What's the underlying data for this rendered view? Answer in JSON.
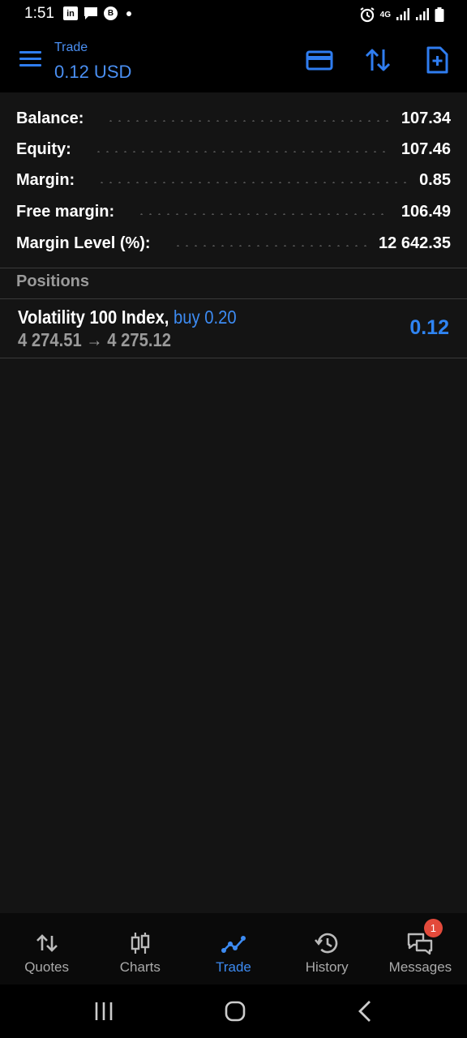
{
  "status_bar": {
    "time": "1:51",
    "left_icons": [
      "linkedin-icon",
      "chat-icon",
      "b-app-icon",
      "dot-icon"
    ],
    "right_icons": [
      "alarm-icon",
      "4g-icon",
      "signal-icon",
      "signal-icon",
      "battery-icon"
    ],
    "network": "4G"
  },
  "header": {
    "title": "Trade",
    "subtitle": "0.12 USD",
    "actions": [
      "card-icon",
      "sort-icon",
      "new-order-icon"
    ]
  },
  "summary": {
    "rows": [
      {
        "label": "Balance:",
        "value": "107.34"
      },
      {
        "label": "Equity:",
        "value": "107.46"
      },
      {
        "label": "Margin:",
        "value": "0.85"
      },
      {
        "label": "Free margin:",
        "value": "106.49"
      },
      {
        "label": "Margin Level (%):",
        "value": "12 642.35"
      }
    ]
  },
  "positions": {
    "title": "Positions",
    "items": [
      {
        "symbol": "Volatility 100 Index,",
        "side": "buy 0.20",
        "prices": "4 274.51 → 4 275.12",
        "profit": "0.12"
      }
    ]
  },
  "bottom_nav": {
    "active": "Trade",
    "items": [
      {
        "label": "Quotes",
        "icon": "quotes-icon"
      },
      {
        "label": "Charts",
        "icon": "charts-icon"
      },
      {
        "label": "Trade",
        "icon": "trade-icon"
      },
      {
        "label": "History",
        "icon": "history-icon"
      },
      {
        "label": "Messages",
        "icon": "messages-icon",
        "badge": "1"
      }
    ]
  },
  "colors": {
    "accent": "#3d8bf2",
    "background": "#141414",
    "header": "#000000",
    "badge": "#e34a3b"
  }
}
